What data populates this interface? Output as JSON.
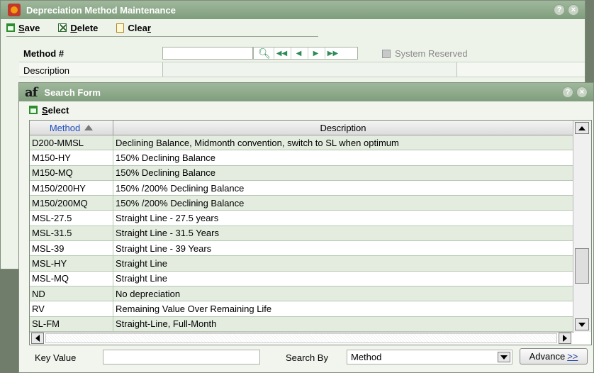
{
  "main_window": {
    "title": "Depreciation Method Maintenance",
    "toolbar": {
      "save_pre": "",
      "save_ul": "S",
      "save_post": "ave",
      "delete_pre": "",
      "delete_ul": "D",
      "delete_post": "elete",
      "clear_pre": "Clea",
      "clear_ul": "r",
      "clear_post": ""
    },
    "method_label": "Method #",
    "method_value": "",
    "system_reserved_label": "System Reserved",
    "system_reserved_checked": false,
    "description_label": "Description",
    "description_value": ""
  },
  "search_form": {
    "logo": "af",
    "title": "Search Form",
    "select_pre": "",
    "select_ul": "S",
    "select_post": "elect",
    "columns": {
      "method": "Method",
      "description": "Description"
    },
    "sort_column": "Method",
    "sort_direction": "ascending",
    "rows": [
      {
        "method": "D200-MMSL",
        "description": "Declining Balance, Midmonth convention, switch to SL when optimum"
      },
      {
        "method": "M150-HY",
        "description": "150% Declining Balance"
      },
      {
        "method": "M150-MQ",
        "description": "150% Declining Balance"
      },
      {
        "method": "M150/200HY",
        "description": "150% /200% Declining Balance"
      },
      {
        "method": "M150/200MQ",
        "description": "150% /200% Declining Balance"
      },
      {
        "method": "MSL-27.5",
        "description": "Straight Line - 27.5 years"
      },
      {
        "method": "MSL-31.5",
        "description": "Straight Line - 31.5 Years"
      },
      {
        "method": "MSL-39",
        "description": "Straight Line - 39 Years"
      },
      {
        "method": "MSL-HY",
        "description": "Straight Line"
      },
      {
        "method": "MSL-MQ",
        "description": "Straight Line"
      },
      {
        "method": "ND",
        "description": "No depreciation"
      },
      {
        "method": "RV",
        "description": "Remaining Value Over Remaining Life"
      },
      {
        "method": "SL-FM",
        "description": "Straight-Line, Full-Month"
      }
    ],
    "key_value_label": "Key Value",
    "key_value": "",
    "search_by_label": "Search By",
    "search_by_value": "Method",
    "advance_label": "Advance",
    "advance_suffix": ">>"
  },
  "icons": {
    "titlebar_help": "?",
    "titlebar_close": "×",
    "nav": [
      "search-icon",
      "first-record-icon",
      "previous-record-icon",
      "next-record-icon",
      "last-record-icon"
    ]
  },
  "colors": {
    "titlebar": "#8fae8c",
    "row_alt": "#e3ecdf",
    "header_link": "#1f4fbf"
  }
}
